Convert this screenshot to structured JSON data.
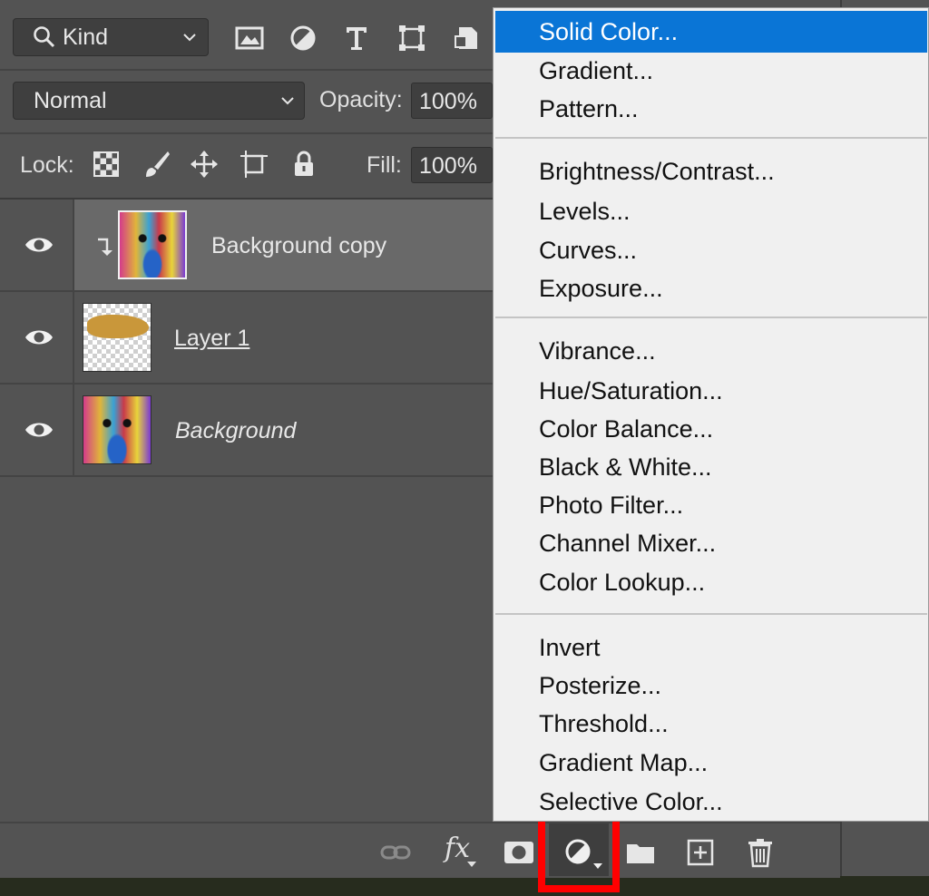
{
  "filter": {
    "kind_label": "Kind",
    "icons": [
      "image-filter-icon",
      "adjustment-filter-icon",
      "type-filter-icon",
      "shape-filter-icon",
      "smart-object-filter-icon"
    ]
  },
  "blend": {
    "mode": "Normal",
    "opacity_label": "Opacity:",
    "opacity_value": "100%"
  },
  "lock": {
    "label": "Lock:",
    "fill_label": "Fill:",
    "fill_value": "100%",
    "icons": [
      "lock-transparent-pixels-icon",
      "lock-image-pixels-icon",
      "lock-position-icon",
      "lock-artboard-icon",
      "lock-all-icon"
    ]
  },
  "layers": [
    {
      "name": "Background copy",
      "selected": true,
      "clipped": true,
      "visible": true
    },
    {
      "name": "Layer 1",
      "selected": false,
      "clipped": false,
      "visible": true
    },
    {
      "name": "Background",
      "selected": false,
      "clipped": false,
      "visible": true
    }
  ],
  "menu": {
    "groups": [
      [
        "Solid Color...",
        "Gradient...",
        "Pattern..."
      ],
      [
        "Brightness/Contrast...",
        "Levels...",
        "Curves...",
        "Exposure..."
      ],
      [
        "Vibrance...",
        "Hue/Saturation...",
        "Color Balance...",
        "Black & White...",
        "Photo Filter...",
        "Channel Mixer...",
        "Color Lookup..."
      ],
      [
        "Invert",
        "Posterize...",
        "Threshold...",
        "Gradient Map...",
        "Selective Color..."
      ]
    ],
    "highlighted": "Solid Color..."
  },
  "bottom_bar": {
    "icons": [
      "link-layers-icon",
      "fx-icon",
      "add-mask-icon",
      "adjustment-layer-icon",
      "new-group-icon",
      "new-layer-icon",
      "delete-layer-icon"
    ],
    "fx_label": "fx"
  },
  "colors": {
    "panel": "#535353",
    "selected_layer": "#696969",
    "menu_highlight": "#0a75d6",
    "callout": "#ff0000"
  }
}
